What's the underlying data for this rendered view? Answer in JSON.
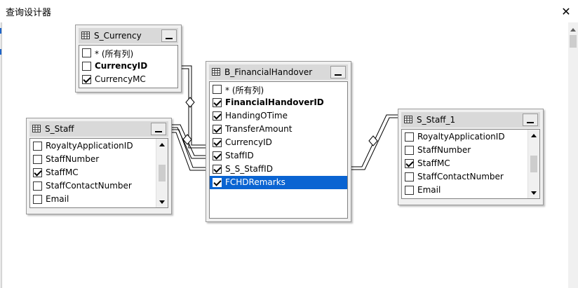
{
  "window": {
    "title": "查询设计器",
    "close_glyph": "✕"
  },
  "tables": {
    "s_currency": {
      "title": "S_Currency",
      "rows": [
        {
          "label": "* (所有列)",
          "checked": false,
          "bold": false
        },
        {
          "label": "CurrencyID",
          "checked": false,
          "bold": true
        },
        {
          "label": "CurrencyMC",
          "checked": true,
          "bold": false
        }
      ]
    },
    "b_financial": {
      "title": "B_FinancialHandover",
      "rows": [
        {
          "label": "* (所有列)",
          "checked": false,
          "bold": false
        },
        {
          "label": "FinancialHandoverID",
          "checked": true,
          "bold": true
        },
        {
          "label": "HandingOTime",
          "checked": true,
          "bold": false
        },
        {
          "label": "TransferAmount",
          "checked": true,
          "bold": false
        },
        {
          "label": "CurrencyID",
          "checked": true,
          "bold": false
        },
        {
          "label": "StaffID",
          "checked": true,
          "bold": false
        },
        {
          "label": "S_S_StaffID",
          "checked": true,
          "bold": false
        },
        {
          "label": "FCHDRemarks",
          "checked": true,
          "bold": false,
          "selected": true
        }
      ]
    },
    "s_staff": {
      "title": "S_Staff",
      "rows": [
        {
          "label": "RoyaltyApplicationID",
          "checked": false,
          "bold": false
        },
        {
          "label": "StaffNumber",
          "checked": false,
          "bold": false
        },
        {
          "label": "StaffMC",
          "checked": true,
          "bold": false
        },
        {
          "label": "StaffContactNumber",
          "checked": false,
          "bold": false
        },
        {
          "label": "Email",
          "checked": false,
          "bold": false
        }
      ]
    },
    "s_staff_1": {
      "title": "S_Staff_1",
      "rows": [
        {
          "label": "RoyaltyApplicationID",
          "checked": false,
          "bold": false
        },
        {
          "label": "StaffNumber",
          "checked": false,
          "bold": false
        },
        {
          "label": "StaffMC",
          "checked": true,
          "bold": false
        },
        {
          "label": "StaffContactNumber",
          "checked": false,
          "bold": false
        },
        {
          "label": "Email",
          "checked": false,
          "bold": false
        }
      ]
    }
  },
  "colors": {
    "selection": "#0a64d2",
    "header": "#d9d9d9",
    "frame": "#f0f0f0"
  }
}
